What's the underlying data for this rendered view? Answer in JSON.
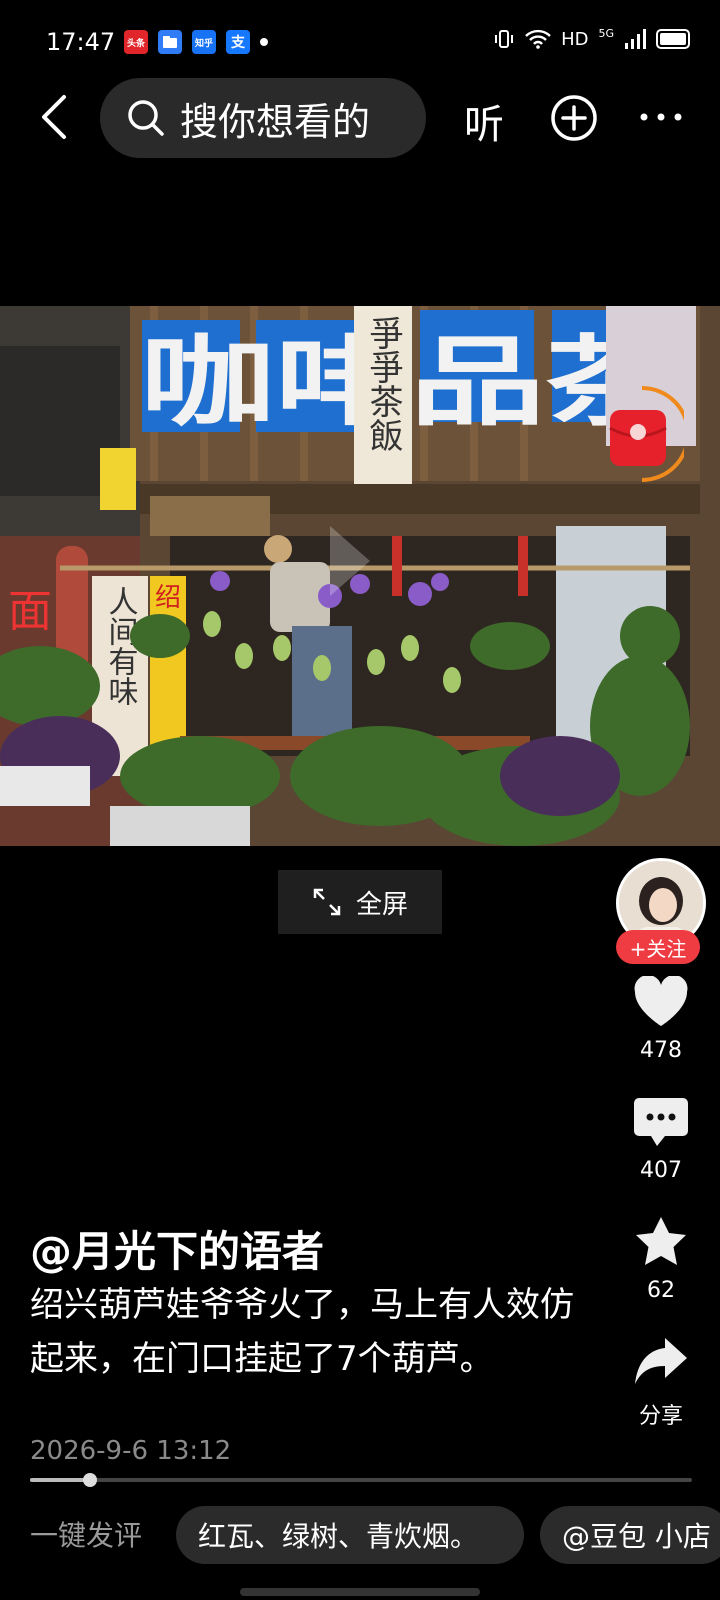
{
  "status_bar": {
    "time": "17:47",
    "app_icons": [
      "头条",
      "文件",
      "知乎",
      "支"
    ],
    "hd": "HD",
    "network": "5G"
  },
  "top_nav": {
    "search_placeholder": "搜你想看的",
    "listen_label": "听"
  },
  "video": {
    "sign_text": "咖啡品茶",
    "banner_text": "爭爭茶飯",
    "left_banner": "人间有味",
    "left_sign": "面",
    "yellow_sign": "绍"
  },
  "fullscreen_label": "全屏",
  "rail": {
    "follow_label": "+关注",
    "like_count": "478",
    "comment_count": "407",
    "favorite_count": "62",
    "share_label": "分享"
  },
  "post": {
    "author": "@月光下的语者",
    "caption": "绍兴葫芦娃爷爷火了，马上有人效仿起来，在门口挂起了7个葫芦。",
    "date": "2026-9-6 13:12",
    "progress": 0.09
  },
  "bottom_bar": {
    "one_click_label": "一键发评",
    "chips": [
      "红瓦、绿树、青炊烟。",
      "@豆包 小店"
    ]
  },
  "colors": {
    "accent_red": "#ef3b42",
    "sign_blue": "#1e6fd0"
  }
}
